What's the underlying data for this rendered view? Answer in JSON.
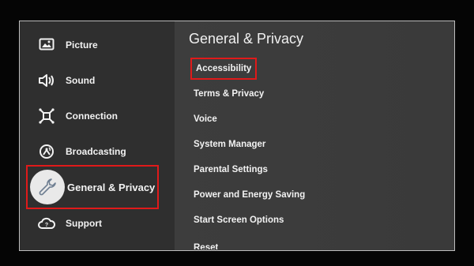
{
  "sidebar": {
    "items": [
      {
        "label": "Picture",
        "icon": "picture-icon"
      },
      {
        "label": "Sound",
        "icon": "sound-icon"
      },
      {
        "label": "Connection",
        "icon": "connection-icon"
      },
      {
        "label": "Broadcasting",
        "icon": "broadcasting-icon"
      },
      {
        "label": "General & Privacy",
        "icon": "wrench-icon"
      },
      {
        "label": "Support",
        "icon": "support-cloud-icon"
      }
    ]
  },
  "main": {
    "title": "General & Privacy",
    "items": [
      {
        "label": "Accessibility"
      },
      {
        "label": "Terms & Privacy"
      },
      {
        "label": "Voice"
      },
      {
        "label": "System Manager"
      },
      {
        "label": "Parental Settings"
      },
      {
        "label": "Power and Energy Saving"
      },
      {
        "label": "Start Screen Options"
      },
      {
        "label": "Reset"
      }
    ]
  },
  "colors": {
    "highlight_border": "#e01a1a",
    "sidebar_bg": "#2f2f2f",
    "main_bg": "#3a3a3a"
  }
}
